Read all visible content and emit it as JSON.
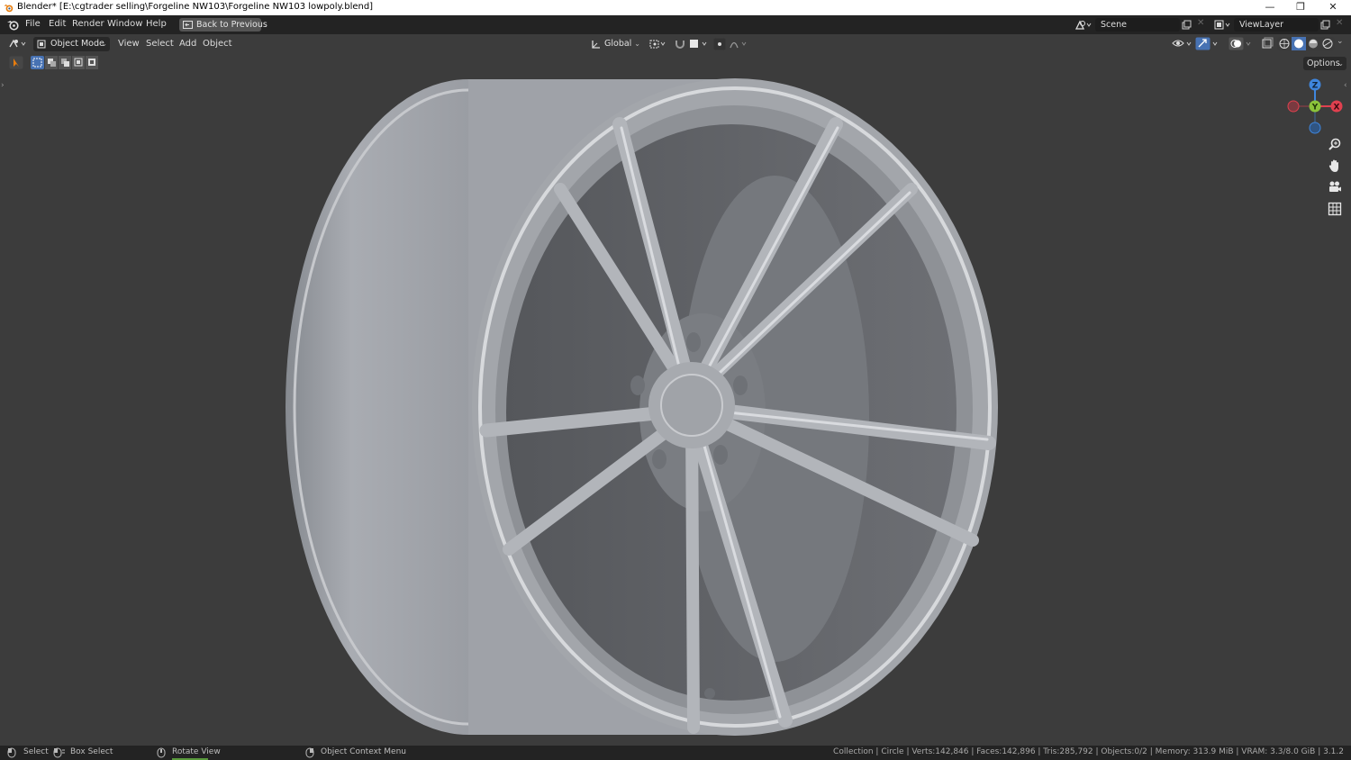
{
  "window": {
    "title": "Blender* [E:\\cgtrader selling\\Forgeline NW103\\Forgeline NW103 lowpoly.blend]",
    "minimize_glyph": "—",
    "restore_glyph": "❐",
    "close_glyph": "✕"
  },
  "topbar": {
    "menus": [
      "File",
      "Edit",
      "Render",
      "Window",
      "Help"
    ],
    "back_button": "Back to Previous",
    "scene_name": "Scene",
    "view_layer_name": "ViewLayer"
  },
  "viewport_header": {
    "mode": "Object Mode",
    "menus": [
      "View",
      "Select",
      "Add",
      "Object"
    ],
    "transform_orientation": "Global",
    "options_label": "Options"
  },
  "gizmo": {
    "z": "Z",
    "y": "Y",
    "x": "X",
    "colors": {
      "x": "#e0404f",
      "y": "#8bc33a",
      "z": "#3f86dd"
    }
  },
  "statusbar": {
    "select": "Select",
    "box_select": "Box Select",
    "rotate_view": "Rotate View",
    "context_menu": "Object Context Menu",
    "stats": "Collection | Circle | Verts:142,846 | Faces:142,896 | Tris:285,792 | Objects:0/2 | Memory: 313.9 MiB | VRAM: 3.3/8.0 GiB | 3.1.2"
  },
  "icons": {
    "editor_type": "view3d-icon",
    "nav_tools": [
      "zoom-icon",
      "pan-hand-icon",
      "camera-icon",
      "grid-ortho-icon"
    ]
  }
}
